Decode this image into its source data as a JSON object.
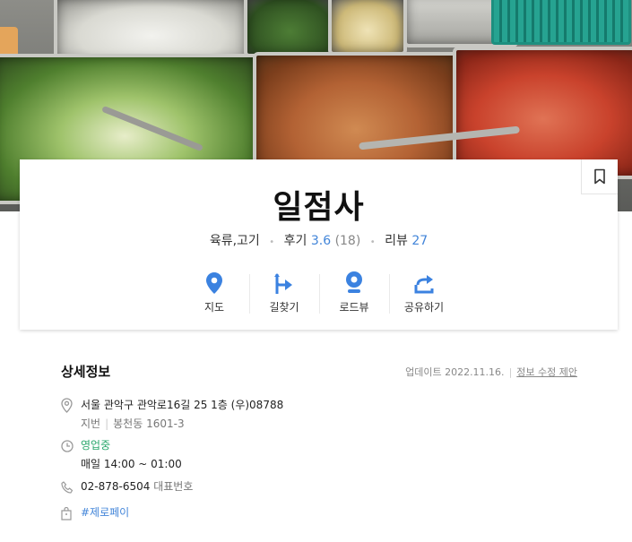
{
  "place": {
    "name": "일점사",
    "category": "육류,고기",
    "review_label": "후기",
    "rating": "3.6",
    "rating_count": "(18)",
    "blog_label": "리뷰",
    "blog_count": "27"
  },
  "actions": [
    {
      "label": "지도",
      "icon": "map-pin-icon"
    },
    {
      "label": "길찾기",
      "icon": "directions-icon"
    },
    {
      "label": "로드뷰",
      "icon": "roadview-icon"
    },
    {
      "label": "공유하기",
      "icon": "share-icon"
    }
  ],
  "detail": {
    "title": "상세정보",
    "updated": "업데이트 2022.11.16.",
    "edit_link": "정보 수정 제안",
    "address": "서울 관악구 관악로16길 25 1층 (우)08788",
    "jibun_label": "지번",
    "jibun": "봉천동 1601-3",
    "status": "영업중",
    "hours": "매일  14:00 ~ 01:00",
    "phone": "02-878-6504",
    "phone_label": "대표번호",
    "tag": "#제로페이"
  },
  "colors": {
    "accent": "#4285d9",
    "open_status": "#2aa66b"
  }
}
